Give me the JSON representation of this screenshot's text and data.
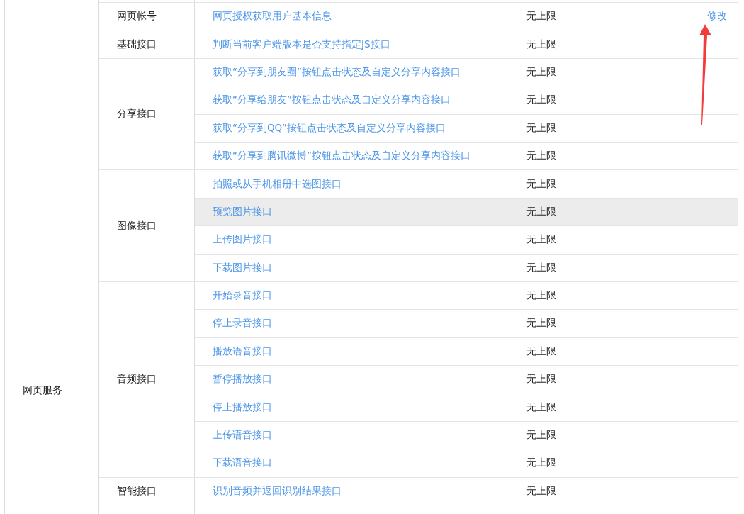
{
  "service": "网页服务",
  "groups": [
    {
      "category": "网页帐号",
      "apis": [
        {
          "name": "网页授权获取用户基本信息",
          "limit": "无上限",
          "action": "修改",
          "highlighted": false
        }
      ]
    },
    {
      "category": "基础接口",
      "apis": [
        {
          "name": "判断当前客户端版本是否支持指定JS接口",
          "limit": "无上限",
          "highlighted": false
        }
      ]
    },
    {
      "category": "分享接口",
      "apis": [
        {
          "name": "获取“分享到朋友圈”按钮点击状态及自定义分享内容接口",
          "limit": "无上限",
          "highlighted": false
        },
        {
          "name": "获取“分享给朋友”按钮点击状态及自定义分享内容接口",
          "limit": "无上限",
          "highlighted": false
        },
        {
          "name": "获取“分享到QQ”按钮点击状态及自定义分享内容接口",
          "limit": "无上限",
          "highlighted": false
        },
        {
          "name": "获取“分享到腾讯微博”按钮点击状态及自定义分享内容接口",
          "limit": "无上限",
          "highlighted": false
        }
      ]
    },
    {
      "category": "图像接口",
      "apis": [
        {
          "name": "拍照或从手机相册中选图接口",
          "limit": "无上限",
          "highlighted": false
        },
        {
          "name": "预览图片接口",
          "limit": "无上限",
          "highlighted": true
        },
        {
          "name": "上传图片接口",
          "limit": "无上限",
          "highlighted": false
        },
        {
          "name": "下载图片接口",
          "limit": "无上限",
          "highlighted": false
        }
      ]
    },
    {
      "category": "音频接口",
      "apis": [
        {
          "name": "开始录音接口",
          "limit": "无上限",
          "highlighted": false
        },
        {
          "name": "停止录音接口",
          "limit": "无上限",
          "highlighted": false
        },
        {
          "name": "播放语音接口",
          "limit": "无上限",
          "highlighted": false
        },
        {
          "name": "暂停播放接口",
          "limit": "无上限",
          "highlighted": false
        },
        {
          "name": "停止播放接口",
          "limit": "无上限",
          "highlighted": false
        },
        {
          "name": "上传语音接口",
          "limit": "无上限",
          "highlighted": false
        },
        {
          "name": "下载语音接口",
          "limit": "无上限",
          "highlighted": false
        }
      ]
    },
    {
      "category": "智能接口",
      "apis": [
        {
          "name": "识别音频并返回识别结果接口",
          "limit": "无上限",
          "highlighted": false
        }
      ]
    }
  ]
}
